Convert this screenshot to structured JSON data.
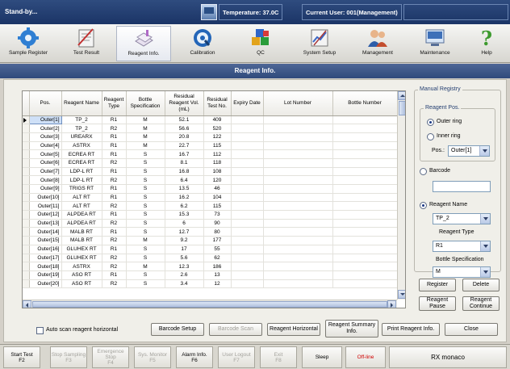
{
  "status_bar": {
    "state": "Stand-by...",
    "temperature": "Temperature: 37.0C",
    "current_user": "Current User: 001(Management)"
  },
  "toolbar": [
    {
      "label": "Sample Register",
      "icon": "gear-icon",
      "active": false
    },
    {
      "label": "Test Result",
      "icon": "test-result-icon",
      "active": false
    },
    {
      "label": "Reagent Info.",
      "icon": "reagent-info-icon",
      "active": true
    },
    {
      "label": "Calibration",
      "icon": "calibration-icon",
      "active": false
    },
    {
      "label": "QC",
      "icon": "qc-cubes-icon",
      "active": false
    },
    {
      "label": "System Setup",
      "icon": "system-setup-icon",
      "active": false
    },
    {
      "label": "Management",
      "icon": "management-icon",
      "active": false
    },
    {
      "label": "Maintenance",
      "icon": "maintenance-icon",
      "active": false
    },
    {
      "label": "Help",
      "icon": "help-icon",
      "active": false
    }
  ],
  "page_title": "Reagent Info.",
  "table": {
    "columns": [
      "Pos.",
      "Reagent Name",
      "Reagent Type",
      "Bottle Specification",
      "Residual Reagent Vol.(mL)",
      "Residual Test No.",
      "Expiry Date",
      "Lot Number",
      "Bottle Number"
    ],
    "rows": [
      [
        "Outer[1]",
        "TP_2",
        "R1",
        "M",
        "52.1",
        "409",
        "",
        "",
        ""
      ],
      [
        "Outer[2]",
        "TP_2",
        "R2",
        "M",
        "56.6",
        "520",
        "",
        "",
        ""
      ],
      [
        "Outer[3]",
        "UREARX",
        "R1",
        "M",
        "20.8",
        "122",
        "",
        "",
        ""
      ],
      [
        "Outer[4]",
        "ASTRX",
        "R1",
        "M",
        "22.7",
        "115",
        "",
        "",
        ""
      ],
      [
        "Outer[5]",
        "ECREA RT",
        "R1",
        "S",
        "16.7",
        "112",
        "",
        "",
        ""
      ],
      [
        "Outer[6]",
        "ECREA RT",
        "R2",
        "S",
        "8.1",
        "118",
        "",
        "",
        ""
      ],
      [
        "Outer[7]",
        "LDP-L RT",
        "R1",
        "S",
        "16.8",
        "108",
        "",
        "",
        ""
      ],
      [
        "Outer[8]",
        "LDP-L RT",
        "R2",
        "S",
        "6.4",
        "120",
        "",
        "",
        ""
      ],
      [
        "Outer[9]",
        "TRIGS RT",
        "R1",
        "S",
        "13.5",
        "46",
        "",
        "",
        ""
      ],
      [
        "Outer[10]",
        "ALT RT",
        "R1",
        "S",
        "16.2",
        "104",
        "",
        "",
        ""
      ],
      [
        "Outer[11]",
        "ALT RT",
        "R2",
        "S",
        "6.2",
        "115",
        "",
        "",
        ""
      ],
      [
        "Outer[12]",
        "ALPDEA RT",
        "R1",
        "S",
        "15.3",
        "73",
        "",
        "",
        ""
      ],
      [
        "Outer[13]",
        "ALPDEA RT",
        "R2",
        "S",
        "6",
        "90",
        "",
        "",
        ""
      ],
      [
        "Outer[14]",
        "MALB RT",
        "R1",
        "S",
        "12.7",
        "80",
        "",
        "",
        ""
      ],
      [
        "Outer[15]",
        "MALB RT",
        "R2",
        "M",
        "9.2",
        "177",
        "",
        "",
        ""
      ],
      [
        "Outer[16]",
        "GLUHEX RT",
        "R1",
        "S",
        "17",
        "55",
        "",
        "",
        ""
      ],
      [
        "Outer[17]",
        "GLUHEX RT",
        "R2",
        "S",
        "5.6",
        "62",
        "",
        "",
        ""
      ],
      [
        "Outer[18]",
        "ASTRX",
        "R2",
        "M",
        "12.3",
        "186",
        "",
        "",
        ""
      ],
      [
        "Outer[19]",
        "ASO RT",
        "R1",
        "S",
        "2.6",
        "13",
        "",
        "",
        ""
      ],
      [
        "Outer[20]",
        "ASO RT",
        "R2",
        "S",
        "3.4",
        "12",
        "",
        "",
        ""
      ]
    ]
  },
  "manual_registry": {
    "title": "Manual Registry",
    "reagent_pos_title": "Reagent Pos.",
    "outer_ring": "Outer ring",
    "inner_ring": "Inner ring",
    "pos_label": "Pos.:",
    "pos_value": "Outer[1]",
    "barcode_label": "Barcode",
    "barcode_value": "",
    "reagent_name_label": "Reagent Name",
    "reagent_name_value": "TP_2",
    "reagent_type_label": "Reagent Type",
    "reagent_type_value": "R1",
    "bottle_spec_label": "Bottle Specification",
    "bottle_spec_value": "M",
    "register": "Register",
    "delete": "Delete",
    "reagent_pause": "Reagent Pause",
    "reagent_continue": "Reagent Continue"
  },
  "bottom_controls": {
    "auto_scan": "Auto scan reagent horizontal",
    "barcode_setup": "Barcode Setup",
    "barcode_scan": "Barcode Scan",
    "reagent_horizontal": "Reagent Horizontal",
    "reagent_summary": "Reagent Summary Info.",
    "print_reagent": "Print Reagent Info.",
    "close": "Close"
  },
  "function_keys": [
    {
      "label": "Start Test",
      "key": "F2",
      "enabled": true
    },
    {
      "label": "Stop Sampling",
      "key": "F3",
      "enabled": false
    },
    {
      "label": "Emergence Stop",
      "key": "F4",
      "enabled": false
    },
    {
      "label": "Sys. Monitor",
      "key": "F5",
      "enabled": false
    },
    {
      "label": "Alarm Info.",
      "key": "F6",
      "enabled": true
    },
    {
      "label": "User Logout",
      "key": "F7",
      "enabled": false
    },
    {
      "label": "Exit",
      "key": "F8",
      "enabled": false
    }
  ],
  "sleep": "Sleep",
  "connection": "Off-line",
  "brand": "RX monaco",
  "colors": {
    "offline": "#d00000",
    "accent": "#2f4a7c"
  }
}
